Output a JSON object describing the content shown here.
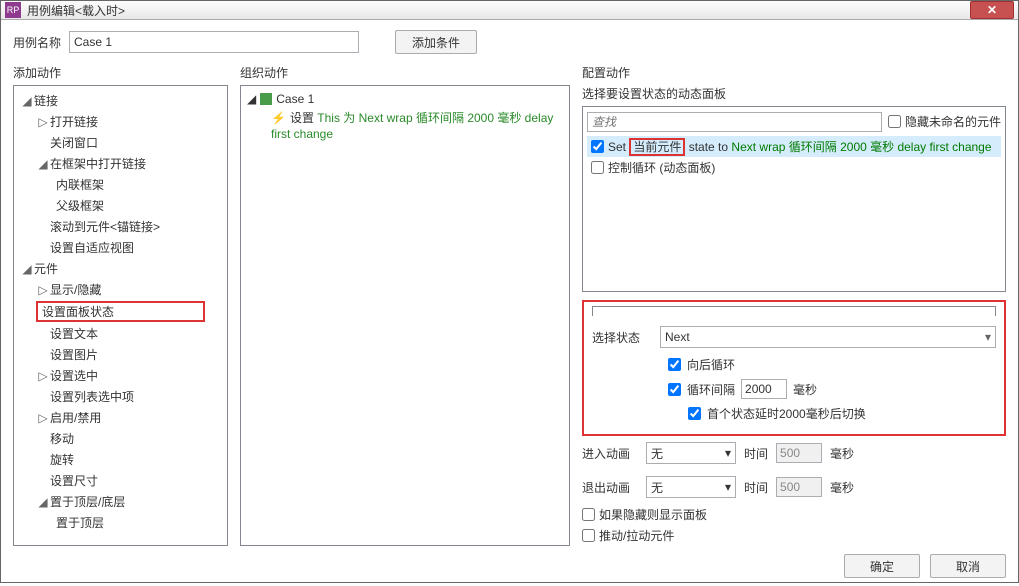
{
  "window": {
    "title": "用例编辑<载入时>"
  },
  "caseName": {
    "label": "用例名称",
    "value": "Case 1"
  },
  "addCondition": "添加条件",
  "col1": {
    "header": "添加动作",
    "groups": {
      "link": {
        "label": "链接",
        "items": [
          "打开链接",
          "关闭窗口"
        ],
        "frame": {
          "label": "在框架中打开链接",
          "items": [
            "内联框架",
            "父级框架"
          ]
        },
        "scroll": "滚动到元件<锚链接>",
        "adaptive": "设置自适应视图"
      },
      "widget": {
        "label": "元件",
        "items": [
          "显示/隐藏",
          "设置面板状态",
          "设置文本",
          "设置图片",
          "设置选中",
          "设置列表选中项",
          "启用/禁用",
          "移动",
          "旋转",
          "设置尺寸"
        ],
        "layer": {
          "label": "置于顶层/底层",
          "items": [
            "置于顶层"
          ]
        }
      }
    }
  },
  "col2": {
    "header": "组织动作",
    "case": "Case 1",
    "action": {
      "prefix": "设置 ",
      "body": "This 为 Next wrap 循环间隔 2000 毫秒 delay first change"
    }
  },
  "col3": {
    "header": "配置动作",
    "panelLabel": "选择要设置状态的动态面板",
    "searchPlaceholder": "查找",
    "hideUnnamed": "隐藏未命名的元件",
    "row1": {
      "p1": "Set ",
      "p2": "当前元件",
      "p3": " state to ",
      "p4": "Next wrap 循环间隔 2000 毫秒 delay first change"
    },
    "row2": "控制循环 (动态面板)",
    "stateLabel": "选择状态",
    "stateValue": "Next",
    "wrap": "向后循环",
    "interval": "循环间隔",
    "intervalVal": "2000",
    "ms": "毫秒",
    "delay": "首个状态延时2000毫秒后切换",
    "animIn": "进入动画",
    "animOut": "退出动画",
    "none": "无",
    "time": "时间",
    "timeVal": "500",
    "showIfHidden": "如果隐藏则显示面板",
    "pushPull": "推动/拉动元件"
  },
  "footer": {
    "ok": "确定",
    "cancel": "取消"
  }
}
